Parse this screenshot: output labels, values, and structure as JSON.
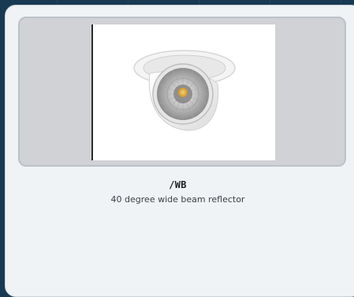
{
  "product": {
    "sku": "/WB",
    "description": "40 degree wide beam reflector",
    "image_subject": "recessed adjustable downlight with wide beam reflector"
  },
  "colors": {
    "page_background": "#173a52",
    "card_background": "#eff3f6",
    "image_panel_background": "#d0d2d5",
    "led_amber": "#e2a832"
  }
}
